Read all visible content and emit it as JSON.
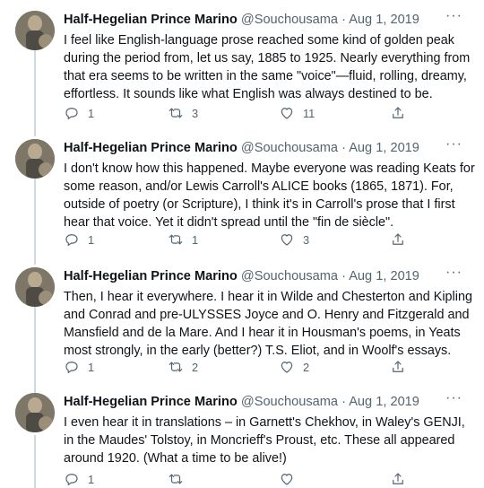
{
  "tweets": [
    {
      "name": "Half-Hegelian Prince Marino",
      "handle": "@Souchousama",
      "sep": "·",
      "date": "Aug 1, 2019",
      "more": "···",
      "text": "I feel like English-language prose reached some kind of golden peak during the period from, let us say, 1885 to 1925. Nearly everything from that era seems to be written in the same \"voice\"—fluid, rolling, dreamy, effortless. It sounds like what English was always destined to be.",
      "replies": "1",
      "retweets": "3",
      "likes": "11"
    },
    {
      "name": "Half-Hegelian Prince Marino",
      "handle": "@Souchousama",
      "sep": "·",
      "date": "Aug 1, 2019",
      "more": "···",
      "text": "I don't know how this happened. Maybe everyone was reading Keats for some reason, and/or Lewis Carroll's ALICE books (1865, 1871). For, outside of poetry (or Scripture), I think it's in Carroll's prose that I first hear that voice. Yet it didn't spread until the \"fin de siècle\".",
      "replies": "1",
      "retweets": "1",
      "likes": "3"
    },
    {
      "name": "Half-Hegelian Prince Marino",
      "handle": "@Souchousama",
      "sep": "·",
      "date": "Aug 1, 2019",
      "more": "···",
      "text": "Then, I hear it everywhere. I hear it in Wilde and Chesterton and Kipling and Conrad and pre-ULYSSES Joyce and O. Henry and Fitzgerald and Mansfield and de la Mare. And I hear it in Housman's poems, in Yeats most strongly, in the early (better?) T.S. Eliot, and in Woolf's essays.",
      "replies": "1",
      "retweets": "2",
      "likes": "2"
    },
    {
      "name": "Half-Hegelian Prince Marino",
      "handle": "@Souchousama",
      "sep": "·",
      "date": "Aug 1, 2019",
      "more": "···",
      "text": "I even hear it in translations – in Garnett's Chekhov, in Waley's GENJI, in the Maudes' Tolstoy, in Moncrieff's Proust, etc. These all appeared around 1920. (What a time to be alive!)",
      "replies": "1",
      "retweets": "",
      "likes": ""
    }
  ],
  "colors": {
    "text": "#0f1419",
    "muted": "#536471",
    "thread_line": "#cfd9de"
  },
  "icons": [
    "reply-icon",
    "retweet-icon",
    "like-icon",
    "share-icon",
    "more-icon"
  ]
}
